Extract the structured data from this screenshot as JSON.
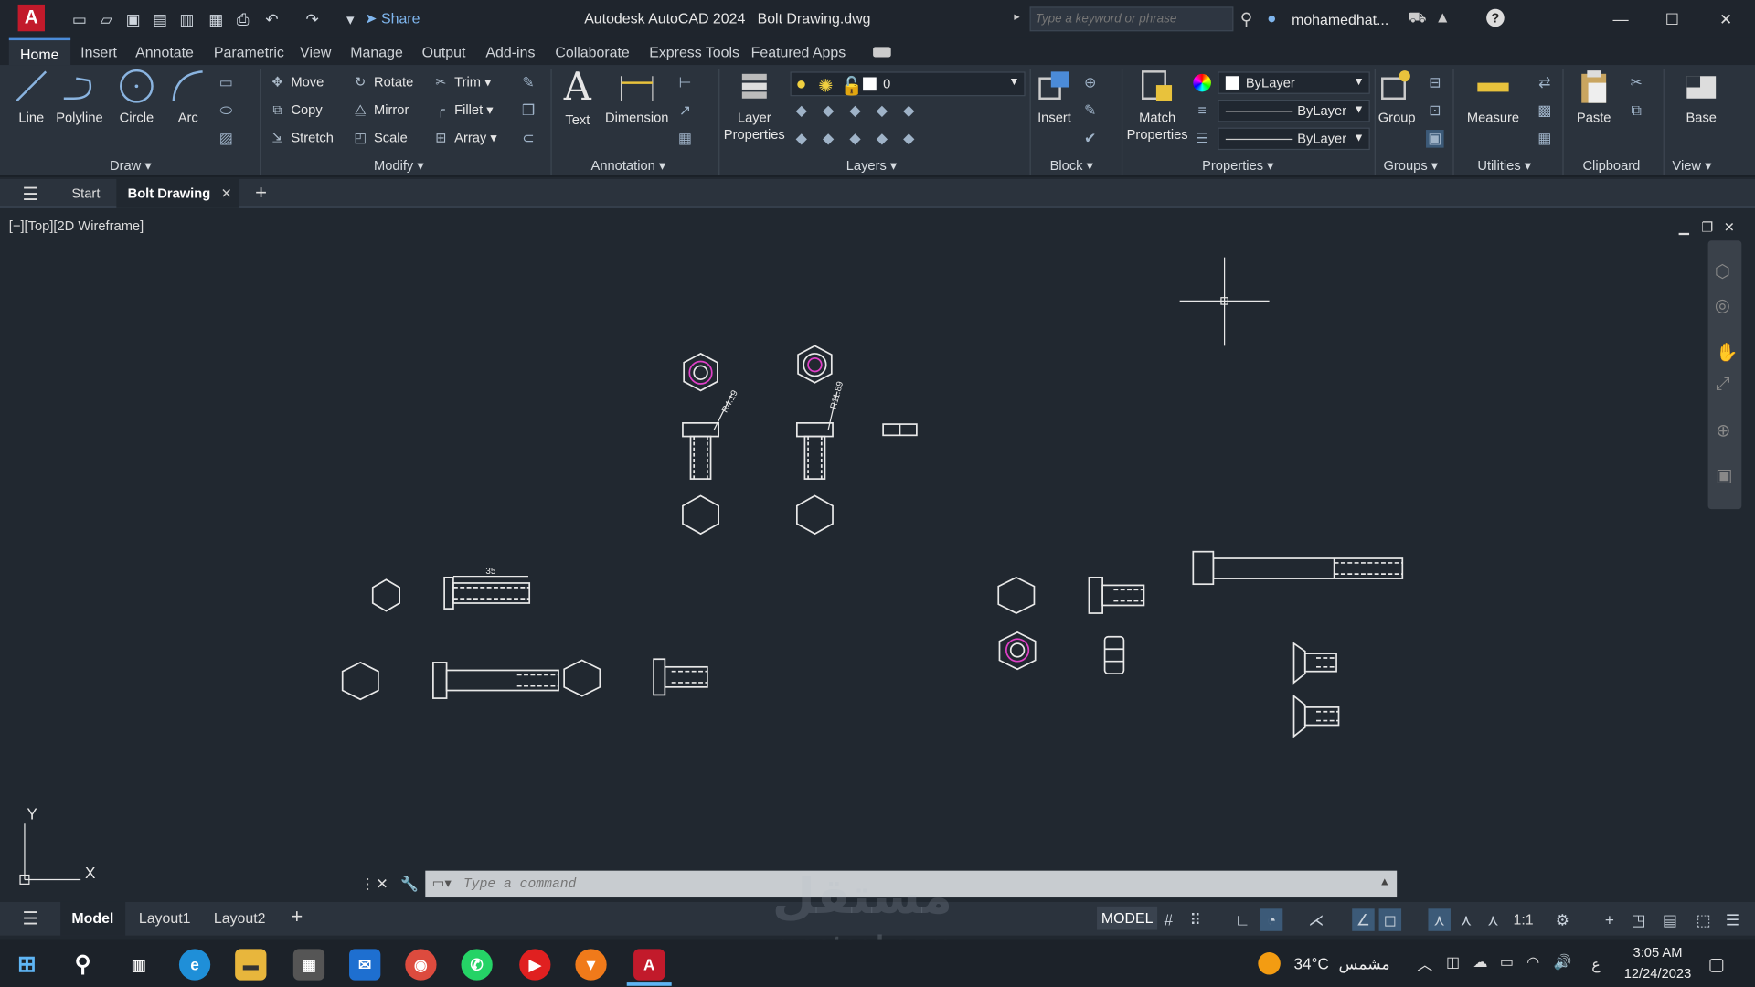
{
  "titlebar": {
    "app_letter": "A",
    "share": "Share",
    "app_title": "Autodesk AutoCAD 2024",
    "file_name": "Bolt Drawing.dwg",
    "search_placeholder": "Type a keyword or phrase",
    "user": "mohamedhat..."
  },
  "ribbon_tabs": [
    "Home",
    "Insert",
    "Annotate",
    "Parametric",
    "View",
    "Manage",
    "Output",
    "Add-ins",
    "Collaborate",
    "Express Tools",
    "Featured Apps"
  ],
  "draw": {
    "line": "Line",
    "polyline": "Polyline",
    "circle": "Circle",
    "arc": "Arc",
    "panel": "Draw"
  },
  "modify": {
    "move": "Move",
    "rotate": "Rotate",
    "trim": "Trim",
    "copy": "Copy",
    "mirror": "Mirror",
    "fillet": "Fillet",
    "stretch": "Stretch",
    "scale": "Scale",
    "array": "Array",
    "panel": "Modify"
  },
  "annotation": {
    "text": "Text",
    "dimension": "Dimension",
    "panel": "Annotation"
  },
  "layers": {
    "layer_properties": "Layer Properties",
    "current_layer": "0",
    "panel": "Layers"
  },
  "block": {
    "insert": "Insert",
    "panel": "Block"
  },
  "properties": {
    "match": "Match Properties",
    "color": "ByLayer",
    "linetype": "ByLayer",
    "lineweight": "ByLayer",
    "panel": "Properties"
  },
  "groups": {
    "group": "Group",
    "panel": "Groups"
  },
  "utilities": {
    "measure": "Measure",
    "panel": "Utilities"
  },
  "clipboard": {
    "paste": "Paste",
    "panel": "Clipboard"
  },
  "view": {
    "base": "Base",
    "panel": "View"
  },
  "doc_tabs": {
    "start": "Start",
    "active": "Bolt Drawing"
  },
  "viewport_label": "[−][Top][2D Wireframe]",
  "dims": {
    "d1": "R4.19",
    "d2": "R11.89",
    "d3": "35"
  },
  "ucs": {
    "y": "Y",
    "x": "X"
  },
  "command": {
    "placeholder": "Type a command"
  },
  "layouts": [
    "Model",
    "Layout1",
    "Layout2"
  ],
  "status": {
    "model": "MODEL",
    "scale": "1:1"
  },
  "watermark": {
    "arabic": "مستقل",
    "latin": "mostaql.com"
  },
  "taskbar": {
    "temp": "34°C",
    "weather": "مشمس",
    "lang": "ع",
    "time": "3:05 AM",
    "date": "12/24/2023"
  },
  "colors": {
    "accent": "#4b8bd8",
    "brand": "#c21a2b",
    "magenta": "#e040c8",
    "drawing": "#e8e8e8"
  }
}
